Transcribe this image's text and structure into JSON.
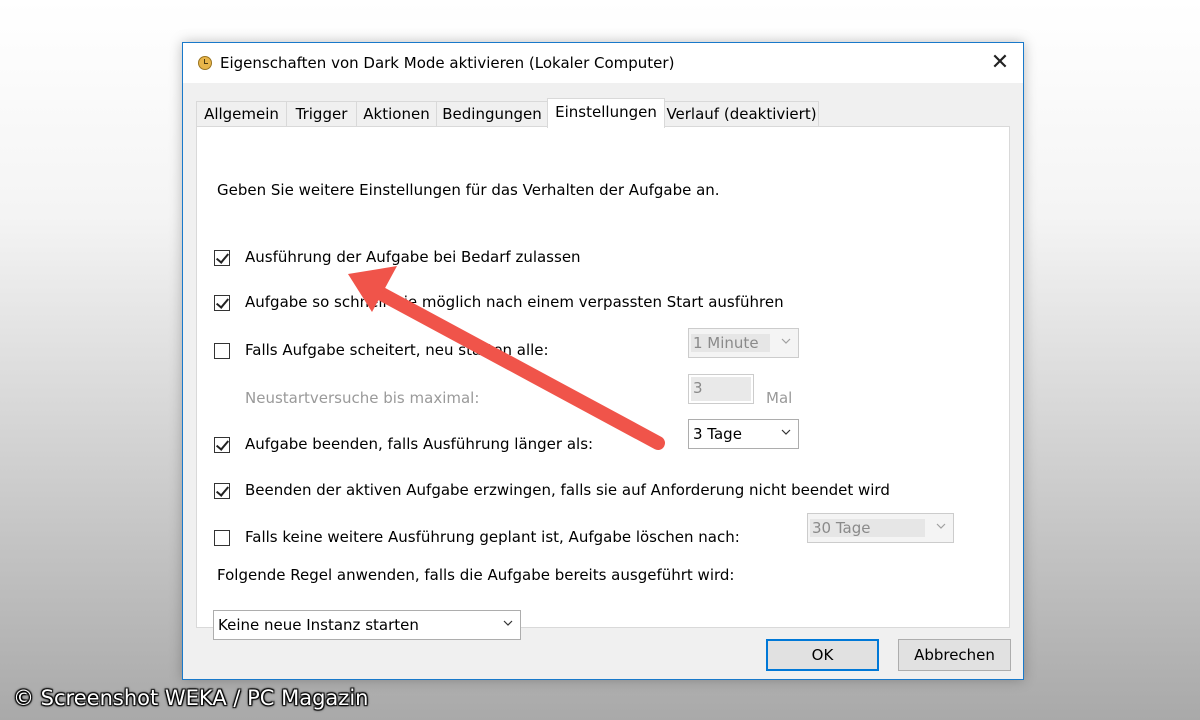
{
  "dialog": {
    "title": "Eigenschaften von Dark Mode aktivieren (Lokaler Computer)",
    "close_symbol": "✕"
  },
  "tabs": [
    {
      "label": "Allgemein"
    },
    {
      "label": "Trigger"
    },
    {
      "label": "Aktionen"
    },
    {
      "label": "Bedingungen"
    },
    {
      "label": "Einstellungen",
      "active": true
    },
    {
      "label": "Verlauf (deaktiviert)"
    }
  ],
  "settings": {
    "intro": "Geben Sie weitere Einstellungen für das Verhalten der Aufgabe an.",
    "allow_on_demand": {
      "label": "Ausführung der Aufgabe bei Bedarf zulassen",
      "checked": true
    },
    "run_asap": {
      "label": "Aufgabe so schnell wie möglich nach einem verpassten Start ausführen",
      "checked": true
    },
    "restart_on_fail": {
      "label": "Falls Aufgabe scheitert, neu starten alle:",
      "checked": false,
      "interval": "1 Minute"
    },
    "restart_attempts": {
      "label": "Neustartversuche bis maximal:",
      "value": "3",
      "unit": "Mal"
    },
    "stop_if_longer": {
      "label": "Aufgabe beenden, falls Ausführung länger als:",
      "checked": true,
      "duration": "3 Tage"
    },
    "force_stop": {
      "label": "Beenden der aktiven Aufgabe erzwingen, falls sie auf Anforderung nicht beendet wird",
      "checked": true
    },
    "delete_if_not_scheduled": {
      "label": "Falls keine weitere Ausführung geplant ist, Aufgabe löschen nach:",
      "checked": false,
      "duration": "30 Tage"
    },
    "rule_label": "Folgende Regel anwenden, falls die Aufgabe bereits ausgeführt wird:",
    "rule_value": "Keine neue Instanz starten"
  },
  "buttons": {
    "ok": "OK",
    "cancel": "Abbrechen"
  },
  "watermark": "© Screenshot WEKA / PC Magazin",
  "colors": {
    "arrow": "#f0544a",
    "accent": "#0078d7"
  }
}
